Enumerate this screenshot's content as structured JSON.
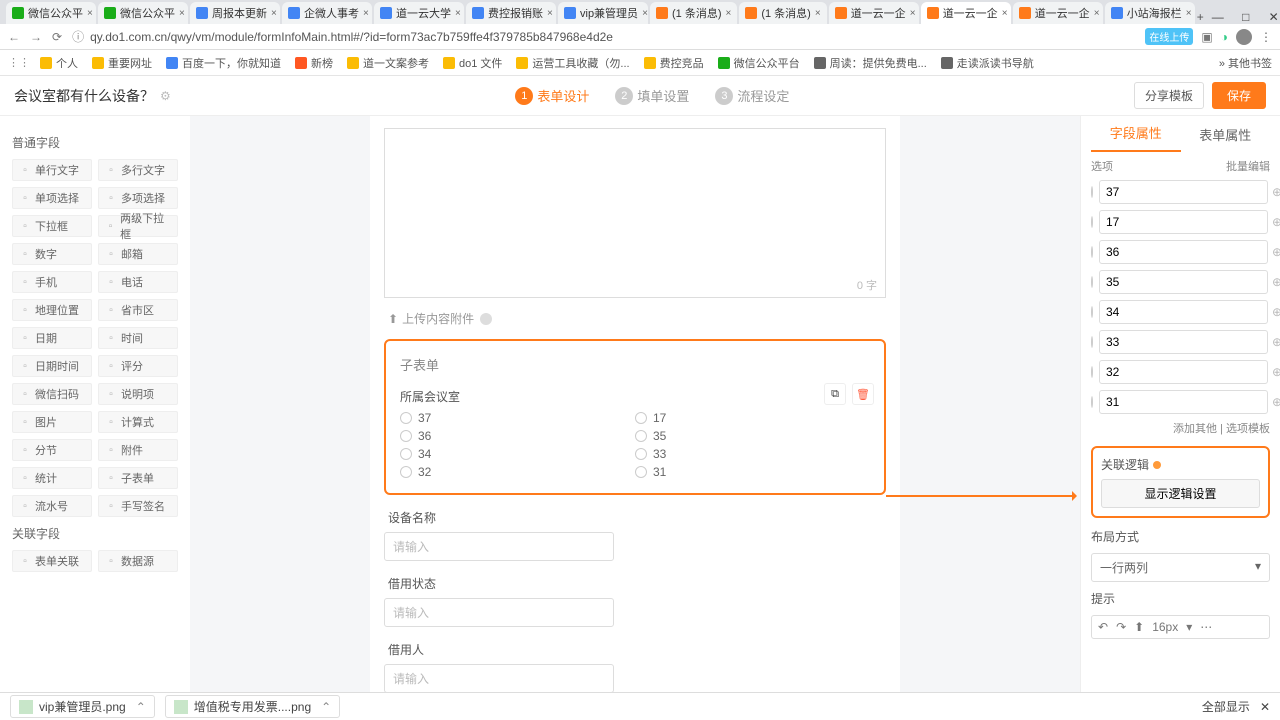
{
  "browser": {
    "tabs": [
      {
        "fav": "#1aad19",
        "label": "微信公众平"
      },
      {
        "fav": "#1aad19",
        "label": "微信公众平"
      },
      {
        "fav": "#4285f4",
        "label": "周报本更新"
      },
      {
        "fav": "#4285f4",
        "label": "企微人事考"
      },
      {
        "fav": "#4285f4",
        "label": "道一云大学"
      },
      {
        "fav": "#4285f4",
        "label": "费控报销账"
      },
      {
        "fav": "#4285f4",
        "label": "vip兼管理员"
      },
      {
        "fav": "#ff7a1a",
        "label": "(1 条消息)"
      },
      {
        "fav": "#ff7a1a",
        "label": "(1 条消息)"
      },
      {
        "fav": "#ff7a1a",
        "label": "道一云一企"
      },
      {
        "fav": "#ff7a1a",
        "label": "道一云一企",
        "active": true
      },
      {
        "fav": "#ff7a1a",
        "label": "道一云一企"
      },
      {
        "fav": "#4285f4",
        "label": "小站海报栏"
      }
    ],
    "url": "qy.do1.com.cn/qwy/vm/module/formInfoMain.html#/?id=form73ac7b759ffe4f379785b847968e4d2e",
    "upload_badge": "在线上传",
    "bookmarks": [
      {
        "c": "#fbbc05",
        "t": "个人"
      },
      {
        "c": "#fbbc05",
        "t": "重要网址"
      },
      {
        "c": "#4285f4",
        "t": "百度一下，你就知道"
      },
      {
        "c": "#ff5722",
        "t": "新榜"
      },
      {
        "c": "#fbbc05",
        "t": "道一文案参考"
      },
      {
        "c": "#fbbc05",
        "t": "do1 文件"
      },
      {
        "c": "#fbbc05",
        "t": "运营工具收藏（勿..."
      },
      {
        "c": "#fbbc05",
        "t": "费控竞品"
      },
      {
        "c": "#1aad19",
        "t": "微信公众平台"
      },
      {
        "c": "#666",
        "t": "周读：提供免费电..."
      },
      {
        "c": "#666",
        "t": "走读派读书导航"
      }
    ],
    "other_bm": "其他书签"
  },
  "header": {
    "title": "会议室都有什么设备？",
    "steps": [
      "表单设计",
      "填单设置",
      "流程设定"
    ],
    "share": "分享模板",
    "save": "保存"
  },
  "left": {
    "sec1": "普通字段",
    "fields1": [
      "单行文字",
      "多行文字",
      "单项选择",
      "多项选择",
      "下拉框",
      "两级下拉框",
      "数字",
      "邮箱",
      "手机",
      "电话",
      "地理位置",
      "省市区",
      "日期",
      "时间",
      "日期时间",
      "评分",
      "微信扫码",
      "说明项",
      "图片",
      "计算式",
      "分节",
      "附件",
      "统计",
      "子表单",
      "流水号",
      "手写签名"
    ],
    "sec2": "关联字段",
    "fields2": [
      "表单关联",
      "数据源"
    ]
  },
  "canvas": {
    "counter": "0 字",
    "upload": "上传内容附件",
    "subform": {
      "title": "子表单",
      "label": "所属会议室",
      "col1": [
        "37",
        "36",
        "34",
        "32"
      ],
      "col2": [
        "17",
        "35",
        "33",
        "31"
      ]
    },
    "f1": {
      "label": "设备名称",
      "ph": "请输入"
    },
    "f2": {
      "label": "借用状态",
      "ph": "请输入"
    },
    "f3": {
      "label": "借用人",
      "ph": "请输入"
    }
  },
  "right": {
    "tab1": "字段属性",
    "tab2": "表单属性",
    "opt_head_l": "选项",
    "opt_head_r": "批量编辑",
    "options": [
      "37",
      "17",
      "36",
      "35",
      "34",
      "33",
      "32",
      "31"
    ],
    "add_other": "添加其他 | 选项模板",
    "logic_title": "关联逻辑",
    "logic_btn": "显示逻辑设置",
    "layout_title": "布局方式",
    "layout_value": "一行两列",
    "hint_title": "提示",
    "fontsize": "16px"
  },
  "downloads": {
    "d1": "vip兼管理员.png",
    "d2": "增值税专用发票....png",
    "show_all": "全部显示"
  }
}
